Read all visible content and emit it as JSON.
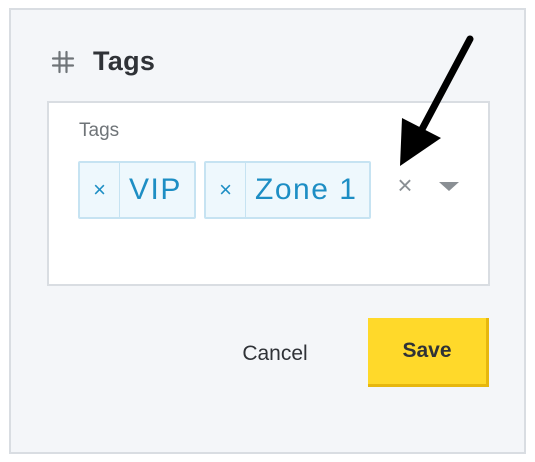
{
  "header": {
    "title": "Tags",
    "icon": "hash-icon"
  },
  "field": {
    "label": "Tags",
    "tags": [
      {
        "label": "VIP",
        "remove_glyph": "×"
      },
      {
        "label": "Zone 1",
        "remove_glyph": "×"
      }
    ],
    "clear_glyph": "×",
    "dropdown_icon": "caret-down-icon"
  },
  "actions": {
    "cancel_label": "Cancel",
    "save_label": "Save"
  },
  "colors": {
    "panel_bg": "#f4f6f9",
    "tag_text": "#1d8ec4",
    "tag_bg": "#eef8fd",
    "save_bg": "#ffd92a",
    "annotation_arrow": "#000000"
  }
}
